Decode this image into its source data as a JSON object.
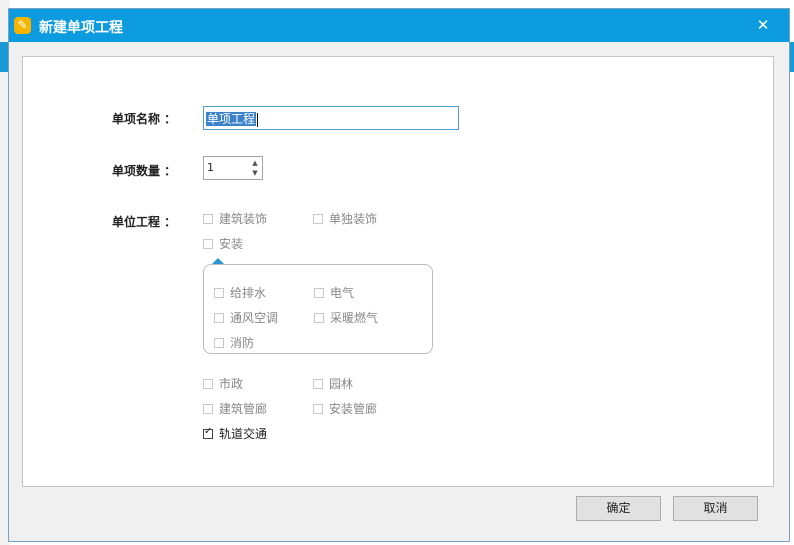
{
  "dialog": {
    "title": "新建单项工程",
    "close_glyph": "✕"
  },
  "form": {
    "name_label": "单项名称 ：",
    "name_value": "单项工程",
    "count_label": "单项数量 ：",
    "count_value": "1",
    "units_label": "单位工程 ："
  },
  "units": {
    "jianzhu_zhuangshi": {
      "label": "建筑装饰",
      "checked": false
    },
    "dandu_zhuangshi": {
      "label": "单独装饰",
      "checked": false
    },
    "anzhuang": {
      "label": "安装",
      "checked": false
    },
    "anzhuang_sub": {
      "geipaishui": {
        "label": "给排水",
        "checked": false
      },
      "dianqi": {
        "label": "电气",
        "checked": false
      },
      "tongfeng": {
        "label": "通风空调",
        "checked": false
      },
      "cainuan": {
        "label": "采暖燃气",
        "checked": false
      },
      "xiaofang": {
        "label": "消防",
        "checked": false
      }
    },
    "shizheng": {
      "label": "市政",
      "checked": false
    },
    "yuanlin": {
      "label": "园林",
      "checked": false
    },
    "jianzhu_guanlang": {
      "label": "建筑管廊",
      "checked": false
    },
    "anzhuang_guanlang": {
      "label": "安装管廊",
      "checked": false
    },
    "guidao": {
      "label": "轨道交通",
      "checked": true
    }
  },
  "buttons": {
    "ok": "确定",
    "cancel": "取消"
  },
  "colors": {
    "titlebar": "#0d9be0",
    "accent": "#2e95d3"
  }
}
